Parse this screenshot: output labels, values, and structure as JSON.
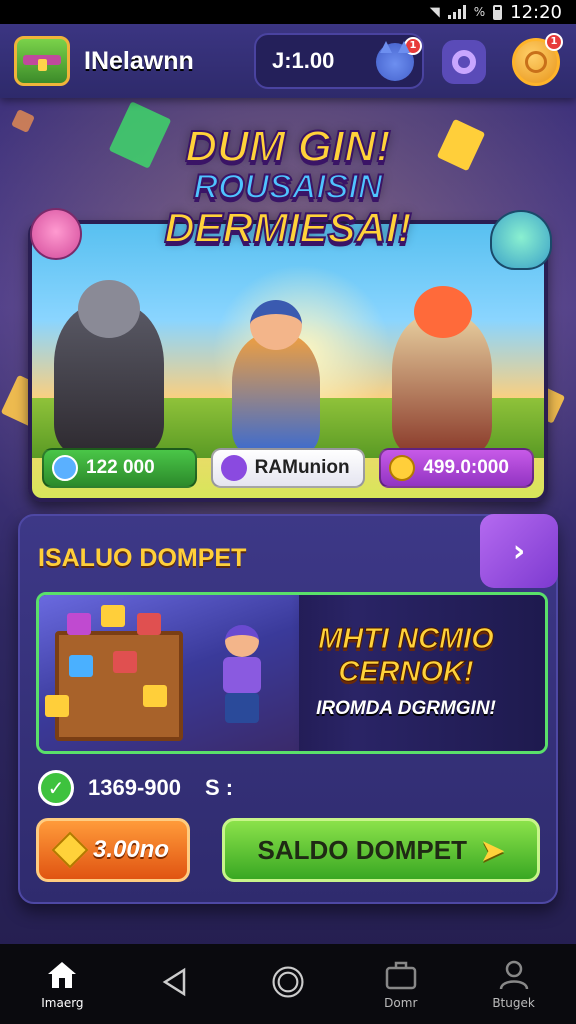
{
  "status_bar": {
    "time": "12:20",
    "battery_percent": "%"
  },
  "header": {
    "username": "INelawnn",
    "balance": "J:1.00",
    "cat_badge": "1",
    "coin_badge": "1"
  },
  "banner": {
    "title_line1": "DUM GIN!",
    "title_line2": "ROUSAISIN",
    "title_line3": "DERMIESAI!",
    "stats": [
      {
        "value": "122 000"
      },
      {
        "value": "RAMunion"
      },
      {
        "value": "499.0:000"
      }
    ]
  },
  "wallet": {
    "title": "ISALUO DOMPET",
    "promo_line1": "MHTI NCMIO",
    "promo_line2": "CERNOK!",
    "promo_line3": "IROMDA DGRMGIN!",
    "balance_value": "1369-900",
    "balance_unit": "S :",
    "orange_button": "3.00no",
    "green_button": "SALDO DOMPET"
  },
  "bottom_nav": [
    {
      "label": "Imaerg",
      "icon": "home-icon"
    },
    {
      "label": "",
      "icon": "back-icon"
    },
    {
      "label": "",
      "icon": "home-circle-icon"
    },
    {
      "label": "Domr",
      "icon": "briefcase-icon"
    },
    {
      "label": "Btugek",
      "icon": "profile-icon"
    }
  ],
  "colors": {
    "accent_gold": "#ffd23a",
    "accent_green": "#39a823",
    "accent_orange": "#e05412",
    "panel": "#2f2b6e"
  }
}
